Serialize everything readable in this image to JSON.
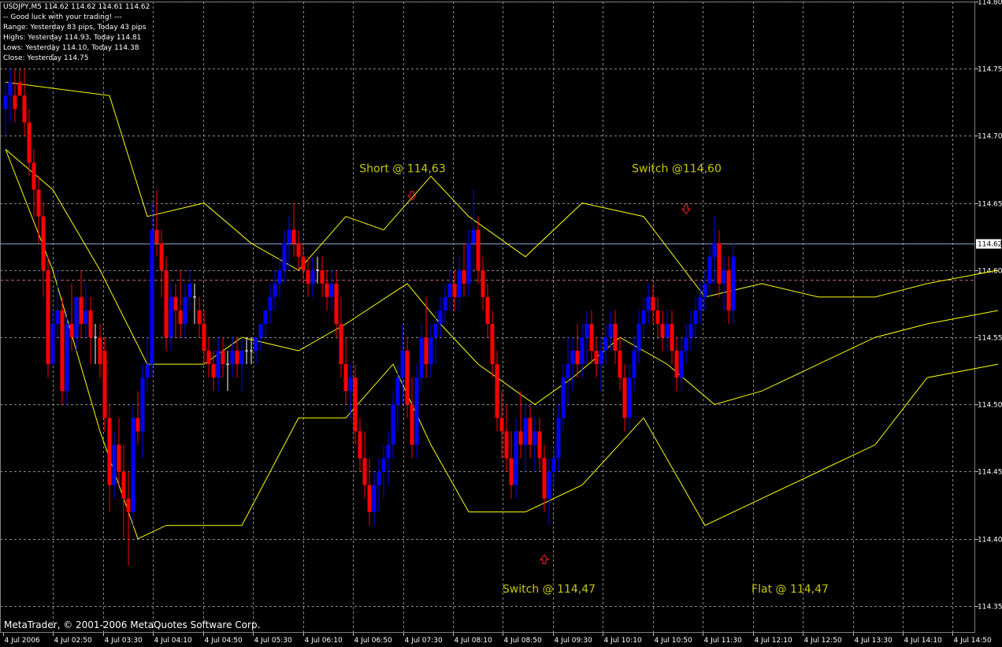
{
  "header": {
    "symbol_line": "USDJPY,M5  114.62 114.62 114.61 114.62",
    "lines": [
      "-- Good luck with your trading! ---",
      "Range: Yesterday 83 pips, Today 43 pips",
      "Highs: Yesterday 114.93, Today 114.81",
      "Lows: Yesterday 114.10, Today 114.38",
      "Close: Yesterday 114.75"
    ]
  },
  "footer": {
    "copyright": "MetaTrader, © 2001-2006 MetaQuotes Software Corp."
  },
  "colors": {
    "background": "#000000",
    "grid": "#8a8a8a",
    "bull_candle": "#0000ff",
    "bear_candle": "#ff0000",
    "doji": "#ffffff",
    "envelope": "#ffff00",
    "annotation": "#c8c800",
    "arrow": "#ff2020",
    "current_price_line": "#8aa0c8",
    "open_line": "#c06080"
  },
  "chart_data": {
    "type": "candlestick",
    "instrument": "USDJPY",
    "timeframe": "M5",
    "ylim": [
      114.33,
      114.8
    ],
    "y_ticks": [
      "114.80",
      "114.75",
      "114.70",
      "114.65",
      "114.60",
      "114.55",
      "114.50",
      "114.45",
      "114.40",
      "114.35"
    ],
    "x_ticks": [
      "4 Jul 2006",
      "4 Jul 02:50",
      "4 Jul 03:30",
      "4 Jul 04:10",
      "4 Jul 04:50",
      "4 Jul 05:30",
      "4 Jul 06:10",
      "4 Jul 06:50",
      "4 Jul 07:30",
      "4 Jul 08:10",
      "4 Jul 08:50",
      "4 Jul 09:30",
      "4 Jul 10:10",
      "4 Jul 10:50",
      "4 Jul 11:30",
      "4 Jul 12:10",
      "4 Jul 12:50",
      "4 Jul 13:30",
      "4 Jul 14:10",
      "4 Jul 14:50"
    ],
    "current_price": 114.62,
    "current_price_label": "114.62",
    "open_line_price": 114.593,
    "candles": [
      [
        114.72,
        114.74,
        114.7,
        114.73
      ],
      [
        114.73,
        114.75,
        114.71,
        114.74
      ],
      [
        114.73,
        114.75,
        114.71,
        114.72
      ],
      [
        114.74,
        114.75,
        114.73,
        114.73
      ],
      [
        114.73,
        114.75,
        114.7,
        114.71
      ],
      [
        114.71,
        114.72,
        114.67,
        114.68
      ],
      [
        114.68,
        114.69,
        114.64,
        114.66
      ],
      [
        114.66,
        114.67,
        114.62,
        114.64
      ],
      [
        114.64,
        114.65,
        114.58,
        114.6
      ],
      [
        114.6,
        114.61,
        114.52,
        114.53
      ],
      [
        114.53,
        114.57,
        114.53,
        114.56
      ],
      [
        114.56,
        114.6,
        114.55,
        114.57
      ],
      [
        114.57,
        114.58,
        114.5,
        114.51
      ],
      [
        114.51,
        114.57,
        114.5,
        114.56
      ],
      [
        114.56,
        114.59,
        114.54,
        114.55
      ],
      [
        114.55,
        114.58,
        114.54,
        114.58
      ],
      [
        114.58,
        114.6,
        114.55,
        114.56
      ],
      [
        114.56,
        114.59,
        114.55,
        114.57
      ],
      [
        114.57,
        114.58,
        114.53,
        114.55
      ],
      [
        114.55,
        114.56,
        114.53,
        114.55
      ],
      [
        114.55,
        114.56,
        114.52,
        114.53
      ],
      [
        114.54,
        114.55,
        114.48,
        114.49
      ],
      [
        114.49,
        114.5,
        114.42,
        114.44
      ],
      [
        114.44,
        114.48,
        114.43,
        114.47
      ],
      [
        114.47,
        114.49,
        114.44,
        114.45
      ],
      [
        114.45,
        114.47,
        114.4,
        114.43
      ],
      [
        114.43,
        114.45,
        114.38,
        114.42
      ],
      [
        114.42,
        114.5,
        114.41,
        114.49
      ],
      [
        114.49,
        114.51,
        114.47,
        114.48
      ],
      [
        114.48,
        114.53,
        114.46,
        114.52
      ],
      [
        114.52,
        114.55,
        114.51,
        114.53
      ],
      [
        114.53,
        114.65,
        114.52,
        114.63
      ],
      [
        114.63,
        114.66,
        114.61,
        114.62
      ],
      [
        114.62,
        114.63,
        114.58,
        114.6
      ],
      [
        114.6,
        114.61,
        114.54,
        114.55
      ],
      [
        114.55,
        114.59,
        114.54,
        114.58
      ],
      [
        114.58,
        114.59,
        114.55,
        114.57
      ],
      [
        114.57,
        114.6,
        114.55,
        114.56
      ],
      [
        114.56,
        114.59,
        114.55,
        114.58
      ],
      [
        114.58,
        114.6,
        114.57,
        114.59
      ],
      [
        114.58,
        114.59,
        114.56,
        114.58
      ],
      [
        114.57,
        114.58,
        114.55,
        114.56
      ],
      [
        114.56,
        114.57,
        114.53,
        114.54
      ],
      [
        114.54,
        114.55,
        114.52,
        114.53
      ],
      [
        114.53,
        114.54,
        114.51,
        114.52
      ],
      [
        114.52,
        114.55,
        114.51,
        114.54
      ],
      [
        114.54,
        114.55,
        114.52,
        114.53
      ],
      [
        114.53,
        114.54,
        114.51,
        114.53
      ],
      [
        114.53,
        114.55,
        114.52,
        114.54
      ],
      [
        114.54,
        114.55,
        114.52,
        114.53
      ],
      [
        114.53,
        114.55,
        114.51,
        114.54
      ],
      [
        114.54,
        114.55,
        114.53,
        114.54
      ],
      [
        114.54,
        114.55,
        114.53,
        114.54
      ],
      [
        114.54,
        114.55,
        114.53,
        114.55
      ],
      [
        114.55,
        114.56,
        114.54,
        114.56
      ],
      [
        114.56,
        114.57,
        114.55,
        114.57
      ],
      [
        114.57,
        114.59,
        114.56,
        114.58
      ],
      [
        114.58,
        114.6,
        114.57,
        114.59
      ],
      [
        114.59,
        114.61,
        114.58,
        114.6
      ],
      [
        114.6,
        114.63,
        114.59,
        114.62
      ],
      [
        114.62,
        114.64,
        114.6,
        114.63
      ],
      [
        114.63,
        114.65,
        114.61,
        114.62
      ],
      [
        114.62,
        114.63,
        114.6,
        114.61
      ],
      [
        114.61,
        114.62,
        114.59,
        114.6
      ],
      [
        114.6,
        114.61,
        114.58,
        114.59
      ],
      [
        114.59,
        114.61,
        114.58,
        114.6
      ],
      [
        114.6,
        114.61,
        114.59,
        114.6
      ],
      [
        114.6,
        114.61,
        114.58,
        114.59
      ],
      [
        114.59,
        114.6,
        114.57,
        114.58
      ],
      [
        114.58,
        114.6,
        114.57,
        114.59
      ],
      [
        114.59,
        114.6,
        114.55,
        114.56
      ],
      [
        114.56,
        114.58,
        114.52,
        114.53
      ],
      [
        114.53,
        114.55,
        114.5,
        114.51
      ],
      [
        114.51,
        114.53,
        114.49,
        114.52
      ],
      [
        114.52,
        114.53,
        114.47,
        114.48
      ],
      [
        114.48,
        114.49,
        114.45,
        114.46
      ],
      [
        114.46,
        114.48,
        114.43,
        114.44
      ],
      [
        114.44,
        114.46,
        114.41,
        114.42
      ],
      [
        114.42,
        114.45,
        114.41,
        114.44
      ],
      [
        114.44,
        114.46,
        114.42,
        114.45
      ],
      [
        114.45,
        114.47,
        114.43,
        114.46
      ],
      [
        114.46,
        114.48,
        114.44,
        114.47
      ],
      [
        114.47,
        114.51,
        114.46,
        114.5
      ],
      [
        114.5,
        114.53,
        114.48,
        114.52
      ],
      [
        114.52,
        114.56,
        114.5,
        114.54
      ],
      [
        114.54,
        114.55,
        114.49,
        114.5
      ],
      [
        114.5,
        114.52,
        114.46,
        114.47
      ],
      [
        114.47,
        114.53,
        114.46,
        114.52
      ],
      [
        114.52,
        114.56,
        114.51,
        114.55
      ],
      [
        114.55,
        114.58,
        114.52,
        114.53
      ],
      [
        114.53,
        114.56,
        114.52,
        114.55
      ],
      [
        114.55,
        114.57,
        114.53,
        114.56
      ],
      [
        114.56,
        114.58,
        114.55,
        114.57
      ],
      [
        114.57,
        114.59,
        114.56,
        114.58
      ],
      [
        114.58,
        114.6,
        114.57,
        114.59
      ],
      [
        114.59,
        114.6,
        114.57,
        114.58
      ],
      [
        114.58,
        114.61,
        114.57,
        114.6
      ],
      [
        114.6,
        114.62,
        114.58,
        114.59
      ],
      [
        114.59,
        114.63,
        114.58,
        114.62
      ],
      [
        114.62,
        114.66,
        114.6,
        114.63
      ],
      [
        114.63,
        114.64,
        114.59,
        114.6
      ],
      [
        114.6,
        114.61,
        114.57,
        114.58
      ],
      [
        114.58,
        114.59,
        114.55,
        114.56
      ],
      [
        114.56,
        114.57,
        114.52,
        114.53
      ],
      [
        114.53,
        114.54,
        114.48,
        114.49
      ],
      [
        114.49,
        114.51,
        114.46,
        114.48
      ],
      [
        114.48,
        114.5,
        114.45,
        114.46
      ],
      [
        114.46,
        114.48,
        114.43,
        114.44
      ],
      [
        114.44,
        114.49,
        114.43,
        114.48
      ],
      [
        114.48,
        114.51,
        114.46,
        114.47
      ],
      [
        114.47,
        114.5,
        114.45,
        114.49
      ],
      [
        114.49,
        114.5,
        114.46,
        114.47
      ],
      [
        114.47,
        114.49,
        114.45,
        114.48
      ],
      [
        114.48,
        114.49,
        114.45,
        114.46
      ],
      [
        114.46,
        114.47,
        114.42,
        114.43
      ],
      [
        114.43,
        114.46,
        114.41,
        114.45
      ],
      [
        114.45,
        114.47,
        114.44,
        114.46
      ],
      [
        114.46,
        114.5,
        114.45,
        114.49
      ],
      [
        114.49,
        114.53,
        114.48,
        114.52
      ],
      [
        114.52,
        114.55,
        114.5,
        114.53
      ],
      [
        114.53,
        114.55,
        114.51,
        114.54
      ],
      [
        114.54,
        114.56,
        114.52,
        114.53
      ],
      [
        114.53,
        114.56,
        114.52,
        114.55
      ],
      [
        114.55,
        114.57,
        114.53,
        114.56
      ],
      [
        114.56,
        114.57,
        114.53,
        114.54
      ],
      [
        114.54,
        114.55,
        114.52,
        114.53
      ],
      [
        114.53,
        114.55,
        114.51,
        114.54
      ],
      [
        114.54,
        114.56,
        114.53,
        114.55
      ],
      [
        114.55,
        114.57,
        114.54,
        114.56
      ],
      [
        114.56,
        114.57,
        114.53,
        114.54
      ],
      [
        114.54,
        114.55,
        114.51,
        114.52
      ],
      [
        114.52,
        114.53,
        114.48,
        114.49
      ],
      [
        114.49,
        114.53,
        114.48,
        114.52
      ],
      [
        114.52,
        114.55,
        114.51,
        114.54
      ],
      [
        114.54,
        114.57,
        114.53,
        114.56
      ],
      [
        114.56,
        114.58,
        114.55,
        114.57
      ],
      [
        114.57,
        114.59,
        114.56,
        114.58
      ],
      [
        114.58,
        114.59,
        114.56,
        114.57
      ],
      [
        114.57,
        114.58,
        114.55,
        114.56
      ],
      [
        114.56,
        114.57,
        114.54,
        114.55
      ],
      [
        114.55,
        114.57,
        114.54,
        114.56
      ],
      [
        114.56,
        114.57,
        114.53,
        114.54
      ],
      [
        114.54,
        114.55,
        114.51,
        114.52
      ],
      [
        114.52,
        114.55,
        114.51,
        114.54
      ],
      [
        114.54,
        114.56,
        114.53,
        114.55
      ],
      [
        114.55,
        114.57,
        114.54,
        114.56
      ],
      [
        114.56,
        114.58,
        114.55,
        114.57
      ],
      [
        114.57,
        114.59,
        114.56,
        114.58
      ],
      [
        114.58,
        114.6,
        114.57,
        114.59
      ],
      [
        114.59,
        114.62,
        114.58,
        114.61
      ],
      [
        114.61,
        114.64,
        114.59,
        114.62
      ],
      [
        114.62,
        114.63,
        114.58,
        114.59
      ],
      [
        114.59,
        114.61,
        114.57,
        114.6
      ],
      [
        114.6,
        114.61,
        114.56,
        114.57
      ],
      [
        114.57,
        114.62,
        114.56,
        114.61
      ]
    ],
    "envelope_upper": [
      [
        0,
        114.74
      ],
      [
        22,
        114.73
      ],
      [
        30,
        114.64
      ],
      [
        42,
        114.65
      ],
      [
        52,
        114.62
      ],
      [
        62,
        114.6
      ],
      [
        72,
        114.64
      ],
      [
        80,
        114.63
      ],
      [
        90,
        114.67
      ],
      [
        98,
        114.64
      ],
      [
        110,
        114.61
      ],
      [
        122,
        114.65
      ],
      [
        135,
        114.64
      ],
      [
        148,
        114.58
      ],
      [
        160,
        114.59
      ],
      [
        172,
        114.58
      ],
      [
        184,
        114.58
      ],
      [
        195,
        114.59
      ],
      [
        210,
        114.6
      ]
    ],
    "envelope_mid": [
      [
        0,
        114.69
      ],
      [
        10,
        114.66
      ],
      [
        20,
        114.6
      ],
      [
        30,
        114.53
      ],
      [
        42,
        114.53
      ],
      [
        50,
        114.55
      ],
      [
        62,
        114.54
      ],
      [
        72,
        114.56
      ],
      [
        85,
        114.59
      ],
      [
        92,
        114.56
      ],
      [
        100,
        114.53
      ],
      [
        112,
        114.5
      ],
      [
        120,
        114.52
      ],
      [
        130,
        114.55
      ],
      [
        140,
        114.53
      ],
      [
        150,
        114.5
      ],
      [
        160,
        114.51
      ],
      [
        172,
        114.53
      ],
      [
        184,
        114.55
      ],
      [
        195,
        114.56
      ],
      [
        210,
        114.57
      ]
    ],
    "envelope_lower": [
      [
        0,
        114.69
      ],
      [
        10,
        114.6
      ],
      [
        20,
        114.48
      ],
      [
        28,
        114.4
      ],
      [
        34,
        114.41
      ],
      [
        50,
        114.41
      ],
      [
        62,
        114.49
      ],
      [
        72,
        114.49
      ],
      [
        82,
        114.53
      ],
      [
        90,
        114.47
      ],
      [
        98,
        114.42
      ],
      [
        110,
        114.42
      ],
      [
        122,
        114.44
      ],
      [
        135,
        114.49
      ],
      [
        148,
        114.41
      ],
      [
        160,
        114.43
      ],
      [
        172,
        114.45
      ],
      [
        184,
        114.47
      ],
      [
        195,
        114.52
      ],
      [
        210,
        114.53
      ]
    ],
    "annotations": [
      {
        "text": "Short @ 114,63",
        "price": 114.673,
        "bar": 84
      },
      {
        "text": "Switch @114,60",
        "price": 114.673,
        "bar": 142
      },
      {
        "text": "Switch @ 114,47",
        "price": 114.36,
        "bar": 115
      },
      {
        "text": "Flat @ 114,47",
        "price": 114.36,
        "bar": 166
      }
    ],
    "arrows": [
      {
        "bar": 86,
        "price": 114.655,
        "dir": "down"
      },
      {
        "bar": 144,
        "price": 114.645,
        "dir": "down"
      },
      {
        "bar": 114,
        "price": 114.385,
        "dir": "up"
      }
    ]
  }
}
